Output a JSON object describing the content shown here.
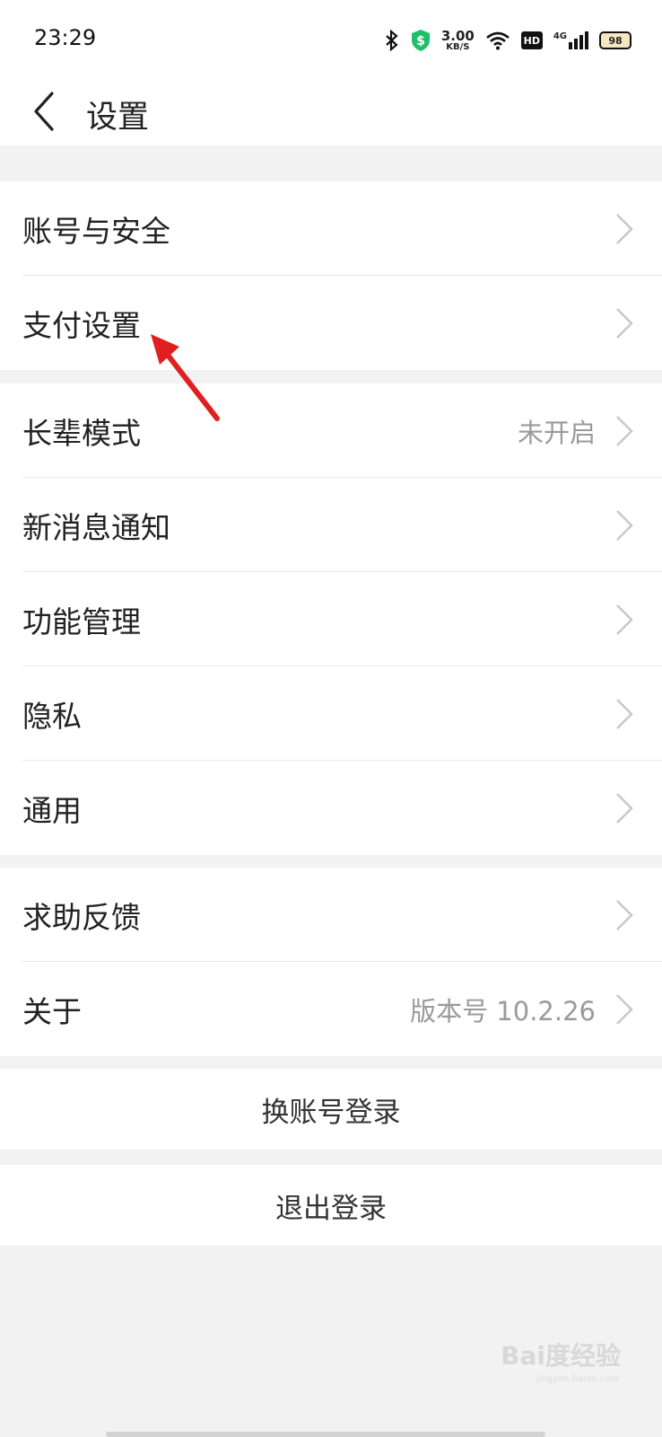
{
  "status": {
    "time": "23:29",
    "speed_value": "3.00",
    "speed_unit": "KB/S",
    "hd": "HD",
    "net": "4G",
    "battery": "98"
  },
  "header": {
    "title": "设置"
  },
  "groups": [
    {
      "items": [
        {
          "label": "账号与安全"
        },
        {
          "label": "支付设置"
        }
      ]
    },
    {
      "items": [
        {
          "label": "长辈模式",
          "value": "未开启"
        },
        {
          "label": "新消息通知"
        },
        {
          "label": "功能管理"
        },
        {
          "label": "隐私"
        },
        {
          "label": "通用"
        }
      ]
    },
    {
      "items": [
        {
          "label": "求助反馈"
        },
        {
          "label": "关于",
          "value": "版本号 10.2.26"
        }
      ]
    }
  ],
  "actions": {
    "switch_account": "换账号登录",
    "logout": "退出登录"
  },
  "watermark": {
    "brand": "Bai度经验",
    "url": "jingyan.baidu.com"
  },
  "colors": {
    "annotation_arrow": "#e02020",
    "background": "#f2f2f2"
  }
}
